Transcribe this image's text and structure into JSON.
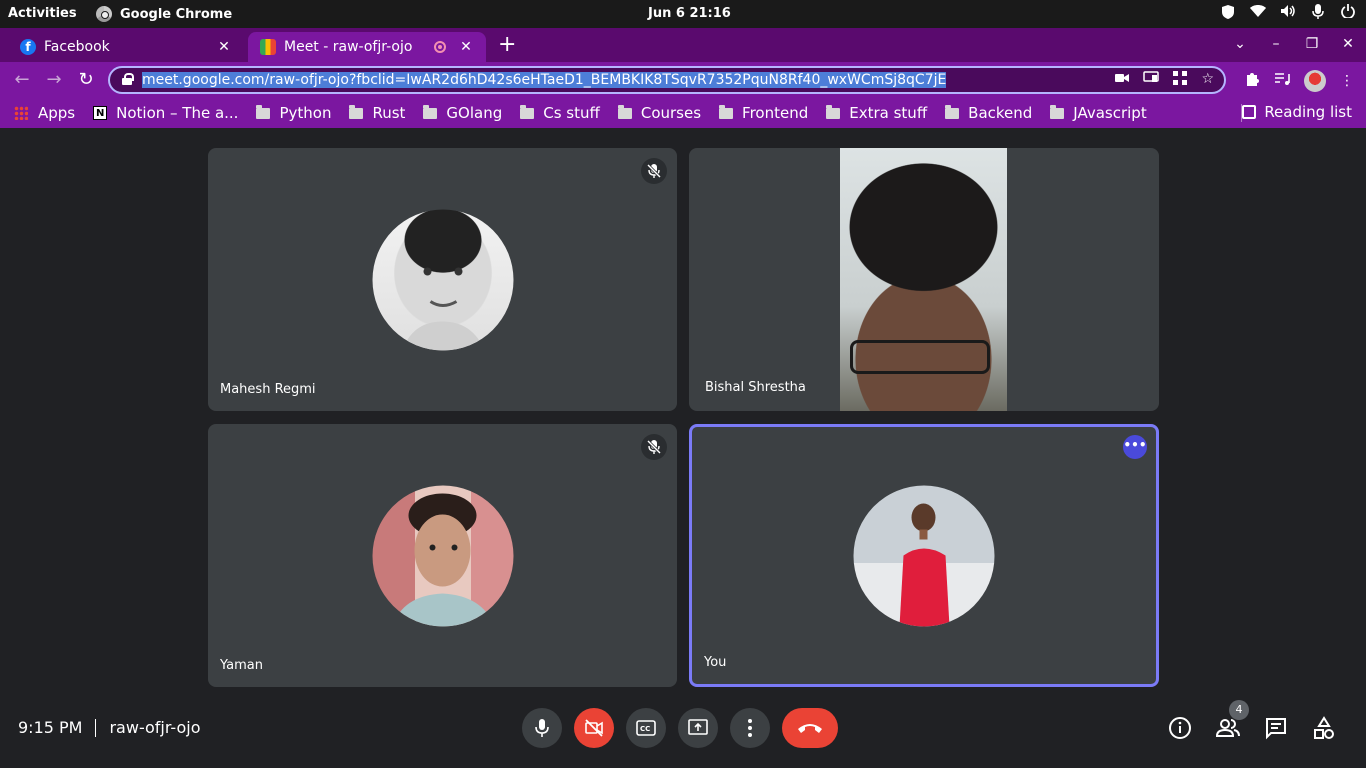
{
  "os": {
    "activities_label": "Activities",
    "app_name": "Google Chrome",
    "clock": "Jun 6  21:16"
  },
  "tabs": [
    {
      "title": "Facebook",
      "icon": "facebook-icon",
      "active": false
    },
    {
      "title": "Meet - raw-ofjr-ojo",
      "icon": "meet-icon",
      "active": true
    }
  ],
  "toolbar": {
    "url": "meet.google.com/raw-ofjr-ojo?fbclid=IwAR2d6hD42s6eHTaeD1_BEMBKIK8TSqvR7352PquN8Rf40_wxWCmSj8qC7jE"
  },
  "bookmarks": {
    "items": [
      "Apps",
      "Notion – The a...",
      "Python",
      "Rust",
      "GOlang",
      "Cs stuff",
      "Courses",
      "Frontend",
      "Extra stuff",
      "Backend",
      "JAvascript"
    ],
    "reading_list": "Reading list"
  },
  "participants": [
    {
      "name": "Mahesh Regmi",
      "muted": true,
      "video": false
    },
    {
      "name": "Bishal Shrestha",
      "muted": false,
      "video": true
    },
    {
      "name": "Yaman",
      "muted": true,
      "video": false
    },
    {
      "name": "You",
      "muted": false,
      "video": false,
      "highlighted": true
    }
  ],
  "meeting": {
    "time": "9:15 PM",
    "code": "raw-ofjr-ojo",
    "people_count": "4"
  },
  "colors": {
    "tabstrip": "#5a0a6e",
    "toolbar": "#7b17a0",
    "meet_bg": "#202124",
    "tile_bg": "#3c4043",
    "end_call": "#ea4335",
    "active_speaker_border": "#7b7bf7"
  }
}
